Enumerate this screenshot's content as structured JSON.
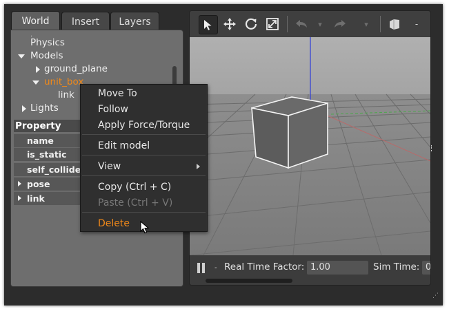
{
  "tabs": [
    {
      "label": "World",
      "active": true
    },
    {
      "label": "Insert",
      "active": false
    },
    {
      "label": "Layers",
      "active": false
    }
  ],
  "tree": {
    "physics": "Physics",
    "models": "Models",
    "ground_plane": "ground_plane",
    "unit_box": "unit_box",
    "link": "link",
    "lights": "Lights"
  },
  "properties": {
    "header": "Property",
    "rows": [
      "name",
      "is_static",
      "self_collide",
      "pose",
      "link"
    ]
  },
  "toolbar": {
    "icons": [
      "select-arrow-icon",
      "translate-icon",
      "rotate-icon",
      "scale-icon",
      "undo-icon",
      "redo-icon",
      "box-shape-icon"
    ]
  },
  "bottombar": {
    "rtf_label": "Real Time Factor:",
    "rtf_value": "1.00",
    "sim_time_label": "Sim Time:",
    "sim_time_value": "0"
  },
  "context_menu": {
    "move_to": "Move To",
    "follow": "Follow",
    "apply_force": "Apply Force/Torque",
    "edit_model": "Edit model",
    "view": "View",
    "copy": "Copy (Ctrl + C)",
    "paste": "Paste (Ctrl + V)",
    "delete": "Delete"
  },
  "colors": {
    "selection_orange": "#f0891a",
    "panel_gray": "#6e6e6e",
    "menu_bg": "#2f2f2f"
  }
}
